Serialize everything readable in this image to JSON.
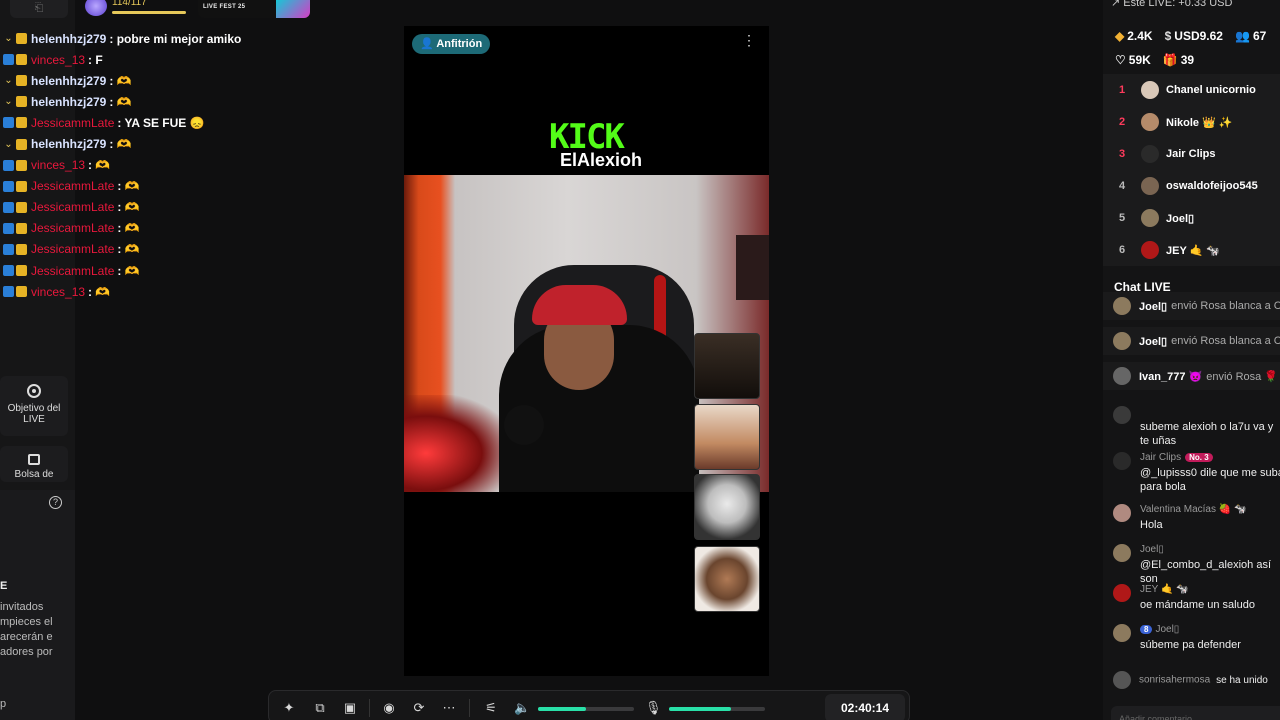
{
  "top": {
    "level_text": "114/117",
    "fest_text": "LIVE FEST 25"
  },
  "overlay_chat": [
    {
      "user": "helenhhzj279",
      "user_color": "light",
      "icon": "arrow",
      "msg": ": pobre mi mejor amiko"
    },
    {
      "user": "vinces_13",
      "user_color": "red",
      "icon": "blue",
      "msg": ": F"
    },
    {
      "user": "helenhhzj279",
      "user_color": "light",
      "icon": "arrow",
      "msg": ": 🫶"
    },
    {
      "user": "helenhhzj279",
      "user_color": "light",
      "icon": "arrow",
      "msg": ": 🫶"
    },
    {
      "user": "JessicammLate",
      "user_color": "red",
      "icon": "blue",
      "msg": ": YA SE FUE 😞"
    },
    {
      "user": "helenhhzj279",
      "user_color": "light",
      "icon": "arrow",
      "msg": ": 🫶"
    },
    {
      "user": "vinces_13",
      "user_color": "red",
      "icon": "blue",
      "msg": ": 🫶"
    },
    {
      "user": "JessicammLate",
      "user_color": "red",
      "icon": "blue",
      "msg": ": 🫶"
    },
    {
      "user": "JessicammLate",
      "user_color": "red",
      "icon": "blue",
      "msg": ": 🫶"
    },
    {
      "user": "JessicammLate",
      "user_color": "red",
      "icon": "blue",
      "msg": ": 🫶"
    },
    {
      "user": "JessicammLate",
      "user_color": "red",
      "icon": "blue",
      "msg": ": 🫶"
    },
    {
      "user": "JessicammLate",
      "user_color": "red",
      "icon": "blue",
      "msg": ": 🫶"
    },
    {
      "user": "vinces_13",
      "user_color": "red",
      "icon": "blue",
      "msg": ": 🫶"
    }
  ],
  "left": {
    "goal_label": "Objetivo del LIVE",
    "bag_label": "Bolsa de",
    "help_glyph": "?",
    "heading": "E",
    "text": "invitados\nmpieces el\narecerán e\nadores por",
    "bottom": "p"
  },
  "video": {
    "host_label": "Anfitrión",
    "kick_logo": "KICK",
    "kick_user": "ElAlexioh"
  },
  "controls": {
    "timer": "02:40:14",
    "volume": 0.5,
    "mic_level": 0.65
  },
  "right": {
    "live_earnings": "Este LIVE: +0.33 USD",
    "stats": {
      "diamonds": "2.4K",
      "usd": "USD9.62",
      "viewers": "67",
      "likes": "59K",
      "gifts": "39"
    },
    "ranking": [
      {
        "rank": "1",
        "name": "Chanel unicornio",
        "avatar_color": "#d9c8b8"
      },
      {
        "rank": "2",
        "name": "Nikole 👑 ✨",
        "avatar_color": "#b58b6a"
      },
      {
        "rank": "3",
        "name": "Jair Clips",
        "avatar_color": "#2a2a2a"
      },
      {
        "rank": "4",
        "name": "oswaldofeijoo545",
        "avatar_color": "#7a6552"
      },
      {
        "rank": "5",
        "name": "Joel▯",
        "avatar_color": "#8c7a5e"
      },
      {
        "rank": "6",
        "name": "JEY 🤙 🐄",
        "avatar_color": "#b01818"
      }
    ],
    "chat_live_title": "Chat LIVE",
    "gifts": [
      {
        "user": "Joel▯",
        "text": "envió Rosa blanca a Ch",
        "avatar_color": "#8c7a5e"
      },
      {
        "user": "Joel▯",
        "text": "envió Rosa blanca a Ch",
        "avatar_color": "#8c7a5e"
      },
      {
        "user": "Ivan_777 👿",
        "text": "envió Rosa 🌹",
        "avatar_color": "#666"
      }
    ],
    "comments": [
      {
        "user": "",
        "pill": "",
        "text": "subeme alexioh o la7u va y te uñas",
        "avatar_color": "#3a3a3a"
      },
      {
        "user": "Jair Clips",
        "pill": "No. 3",
        "text": "@_lupisss0 dile que me suba para bola",
        "avatar_color": "#2a2a2a"
      },
      {
        "user": "Valentina Macías 🍓 🐄",
        "pill": "",
        "text": "Hola",
        "avatar_color": "#b08a80"
      },
      {
        "user": "Joel▯",
        "pill": "",
        "text": "@El_combo_d_alexioh así son",
        "avatar_color": "#8c7a5e"
      },
      {
        "user": "JEY 🤙 🐄",
        "pill": "",
        "text": "oe mándame un saludo",
        "avatar_color": "#b01818"
      },
      {
        "user": "Joel▯",
        "pill_blue": "8",
        "text": "súbeme pa defender",
        "avatar_color": "#8c7a5e"
      }
    ],
    "joined_user": "sonrisahermosa",
    "joined_text": "se ha unido",
    "comment_placeholder": "Añadir comentario..."
  },
  "colors": {
    "accent_green": "#29e0a8",
    "kick_green": "#53fc18",
    "host_badge": "#1d6a77",
    "rank_red": "#ff3b5c",
    "chat_red": "#e8183c"
  }
}
